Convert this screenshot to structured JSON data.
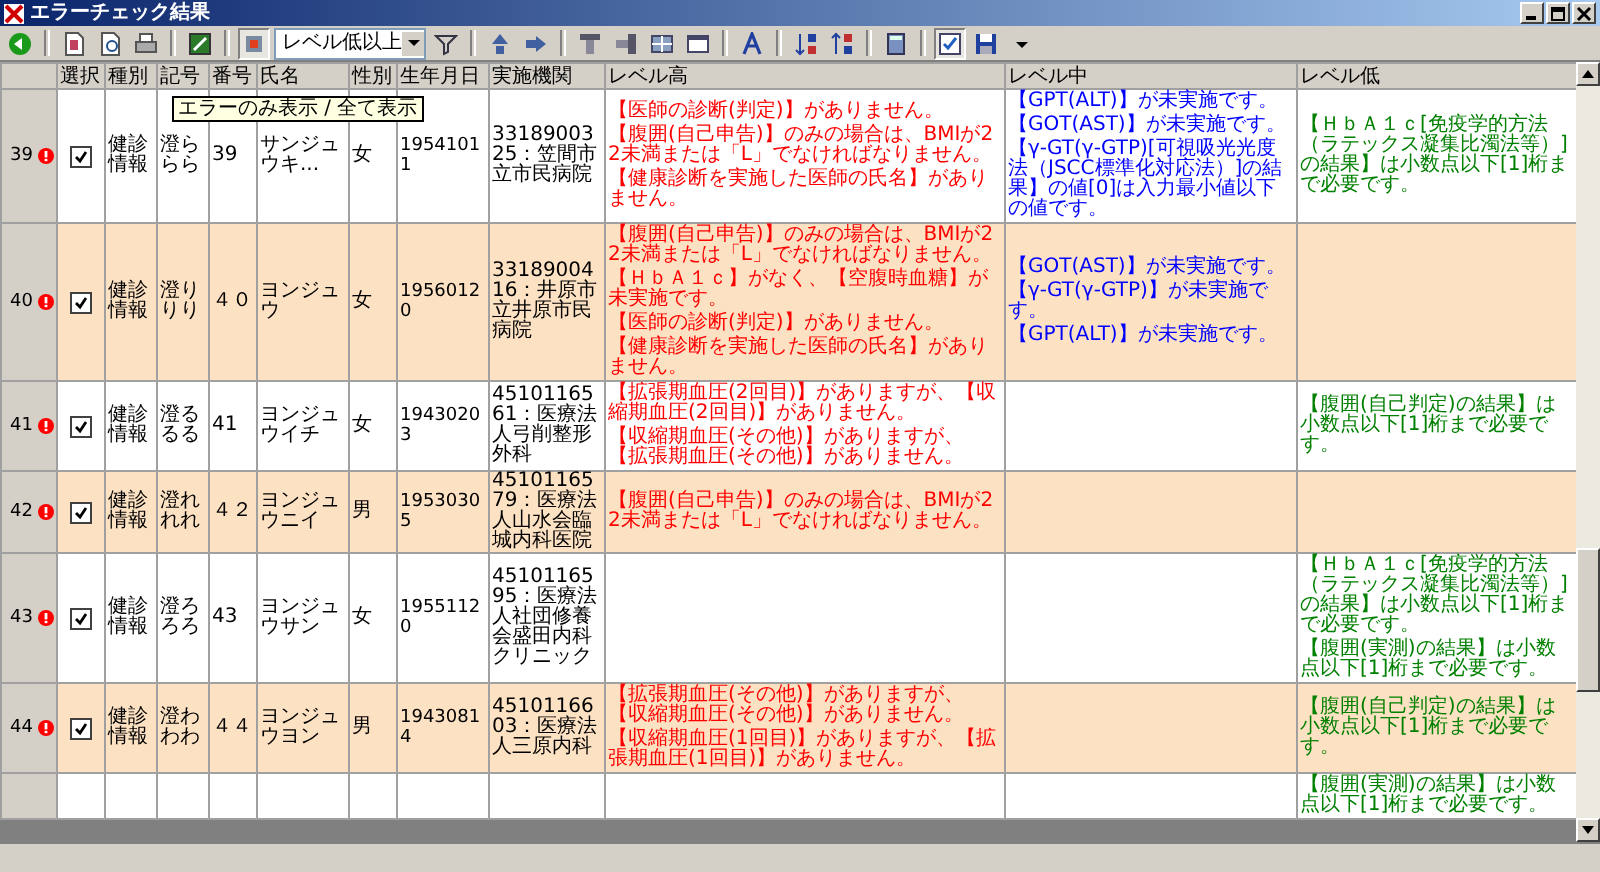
{
  "window": {
    "title": "エラーチェック結果"
  },
  "toolbar": {
    "error_only_pressed": true,
    "level_filter": {
      "value": "レベル低以上"
    },
    "view_toggle_pressed": true,
    "tooltip": "エラーのみ表示 / 全て表示"
  },
  "table": {
    "columns": [
      "選択",
      "種別",
      "記号",
      "番号",
      "氏名",
      "性別",
      "生年月日",
      "実施機関",
      "レベル高",
      "レベル中",
      "レベル低"
    ],
    "rows": [
      {
        "number": "39",
        "error": true,
        "checked": true,
        "type": "健診情報",
        "symbol": "澄ららら",
        "code": "39",
        "name": "サンジュウキ...",
        "sex": "女",
        "birth_date": "19541011",
        "institution": "3318900325：笠間市立市民病院",
        "shaded": false,
        "level_high": [
          "【医師の診断(判定)】がありません。",
          "【腹囲(自己申告)】のみの場合は、BMIが22未満または「L」でなければなりません。",
          "【健康診断を実施した医師の氏名】がありません。"
        ],
        "level_medium": [
          "【GPT(ALT)】が未実施です。",
          "【GOT(AST)】が未実施です。",
          "【γ-GT(γ-GTP)[可視吸光光度法（JSCC標準化対応法）]の結果】の値[0]は入力最小値以下の値です。"
        ],
        "level_low": [
          "【ＨｂＡ１ｃ[免疫学的方法（ラテックス凝集比濁法等）]の結果】は小数点以下[1]桁まで必要です。"
        ]
      },
      {
        "number": "40",
        "error": true,
        "checked": true,
        "type": "健診情報",
        "symbol": "澄りりり",
        "code": "４０",
        "name": "ヨンジュウ",
        "sex": "女",
        "birth_date": "19560120",
        "institution": "3318900416：井原市立井原市民病院",
        "shaded": true,
        "level_high": [
          "【腹囲(自己申告)】のみの場合は、BMIが22未満または「L」でなければなりません。",
          "【ＨｂＡ１ｃ】がなく、【空腹時血糖】が未実施です。",
          "【医師の診断(判定)】がありません。",
          "【健康診断を実施した医師の氏名】がありません。"
        ],
        "level_medium": [
          "【GOT(AST)】が未実施です。",
          "【γ-GT(γ-GTP)】が未実施です。",
          "【GPT(ALT)】が未実施です。"
        ],
        "level_low": []
      },
      {
        "number": "41",
        "error": true,
        "checked": true,
        "type": "健診情報",
        "symbol": "澄るるる",
        "code": "41",
        "name": "ヨンジュウイチ",
        "sex": "女",
        "birth_date": "19430203",
        "institution": "4510116561：医療法人弓削整形外科",
        "shaded": false,
        "level_high": [
          "【拡張期血圧(2回目)】がありますが、【収縮期血圧(2回目)】がありません。",
          "【収縮期血圧(その他)】がありますが、【拡張期血圧(その他)】がありません。"
        ],
        "level_medium": [],
        "level_low": [
          "【腹囲(自己判定)の結果】は小数点以下[1]桁まで必要です。"
        ]
      },
      {
        "number": "42",
        "error": true,
        "checked": true,
        "type": "健診情報",
        "symbol": "澄れれれ",
        "code": "４２",
        "name": "ヨンジュウニイ",
        "sex": "男",
        "birth_date": "19530305",
        "institution": "4510116579：医療法人山水会臨城内科医院",
        "shaded": true,
        "level_high": [
          "【腹囲(自己申告)】のみの場合は、BMIが22未満または「L」でなければなりません。"
        ],
        "level_medium": [],
        "level_low": []
      },
      {
        "number": "43",
        "error": true,
        "checked": true,
        "type": "健診情報",
        "symbol": "澄ろろろ",
        "code": "43",
        "name": "ヨンジュウサン",
        "sex": "女",
        "birth_date": "19551120",
        "institution": "4510116595：医療法人社団修養会盛田内科クリニック",
        "shaded": false,
        "level_high": [],
        "level_medium": [],
        "level_low": [
          "【ＨｂＡ１ｃ[免疫学的方法（ラテックス凝集比濁法等）]の結果】は小数点以下[1]桁まで必要です。",
          "【腹囲(実測)の結果】は小数点以下[1]桁まで必要です。"
        ]
      },
      {
        "number": "44",
        "error": true,
        "checked": true,
        "type": "健診情報",
        "symbol": "澄わわわ",
        "code": "４４",
        "name": "ヨンジュウヨン",
        "sex": "男",
        "birth_date": "19430814",
        "institution": "4510116603：医療法人三原内科",
        "shaded": true,
        "level_high": [
          "【拡張期血圧(その他)】がありますが、【収縮期血圧(その他)】がありません。",
          "【収縮期血圧(1回目)】がありますが、【拡張期血圧(1回目)】がありません。"
        ],
        "level_medium": [],
        "level_low": [
          "【腹囲(自己判定)の結果】は小数点以下[1]桁まで必要です。"
        ]
      },
      {
        "shaded": false,
        "level_low": [
          "【腹囲(実測)の結果】は小数点以下[1]桁まで必要です。"
        ]
      }
    ]
  }
}
